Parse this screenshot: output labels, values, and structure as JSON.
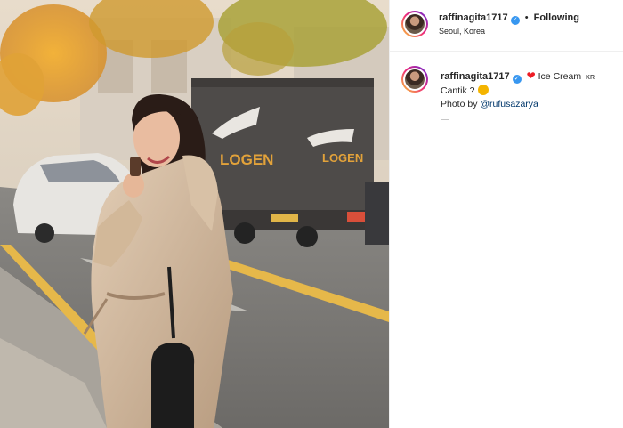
{
  "post": {
    "username": "raffinagita1717",
    "follow_separator": "•",
    "follow_status": "Following",
    "location": "Seoul, Korea"
  },
  "caption": {
    "username": "raffinagita1717",
    "text_part1": "Ice Cream",
    "flag_text": "KR",
    "text_part2": "Cantik ?",
    "photo_credit_prefix": "Photo by",
    "mention": "@rufusazarya"
  },
  "photo": {
    "truck_sign_1": "LOGEN",
    "truck_sign_2": "LOGEN"
  },
  "colors": {
    "verified": "#3897f0",
    "heart": "#ed1c24",
    "mention": "#00376b"
  }
}
